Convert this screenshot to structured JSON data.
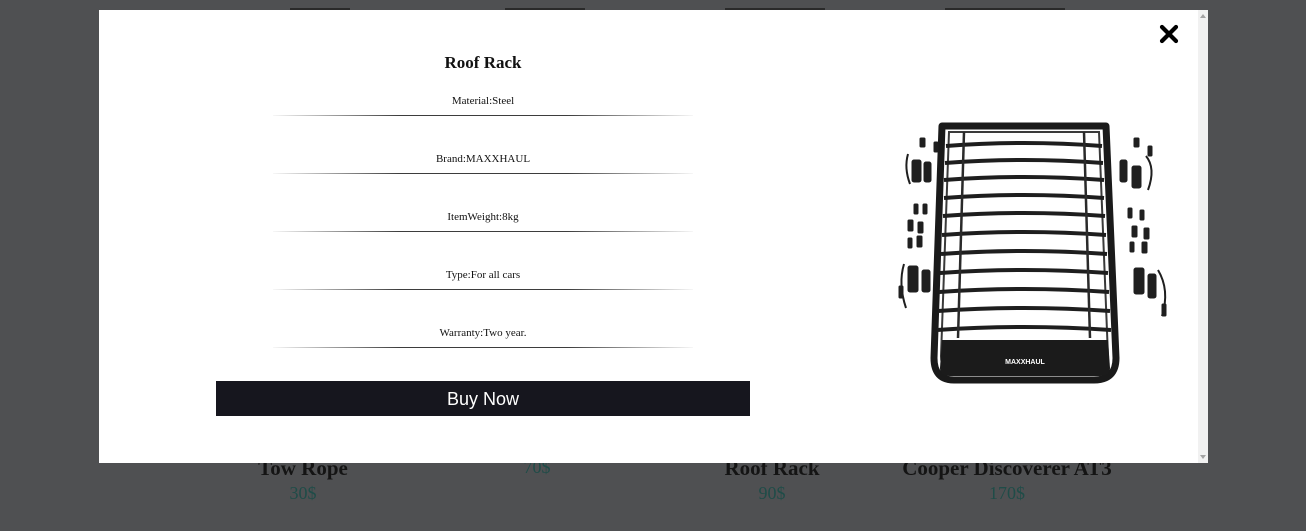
{
  "modal": {
    "title": "Roof Rack",
    "specs": [
      "Material:Steel",
      "Brand:MAXXHAUL",
      "ItemWeight:8kg",
      "Type:For all cars",
      "Warranty:Two year."
    ],
    "buy_label": "Buy Now",
    "image_brand_text": "MAXXHAUL"
  },
  "background_products": [
    {
      "name": "Tow Rope",
      "price": "30$"
    },
    {
      "name": "",
      "price": "70$"
    },
    {
      "name": "Roof Rack",
      "price": "90$"
    },
    {
      "name": "Cooper Discoverer AT3",
      "price": "170$"
    }
  ],
  "icons": {
    "close": "close-x-icon"
  },
  "colors": {
    "overlay": "#4f5052",
    "button_bg": "#16161e",
    "price_text": "#1f4c48"
  }
}
